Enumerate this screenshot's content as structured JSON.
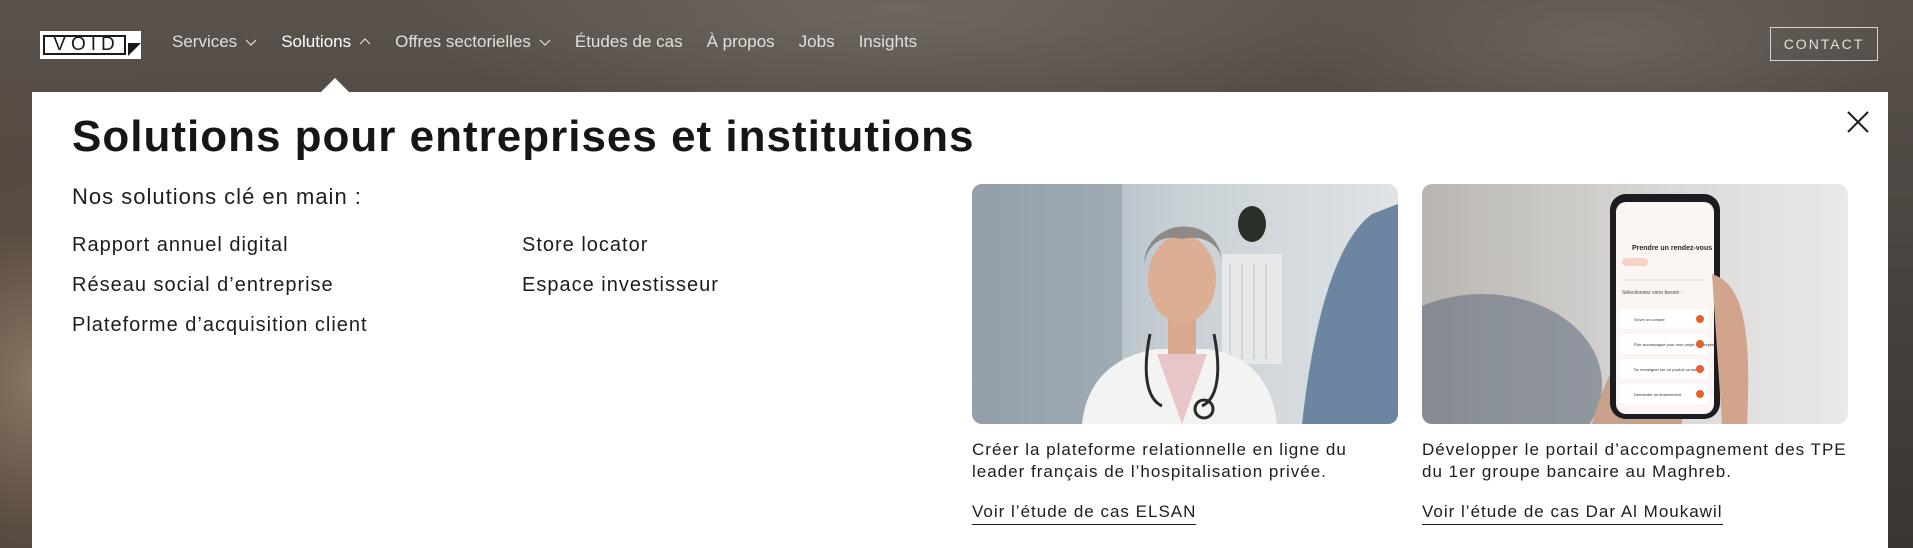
{
  "header": {
    "logo_text": "VOID",
    "nav": [
      {
        "label": "Services",
        "has_chevron": true
      },
      {
        "label": "Solutions",
        "has_chevron": true
      },
      {
        "label": "Offres sectorielles",
        "has_chevron": true
      },
      {
        "label": "Études de cas",
        "has_chevron": false
      },
      {
        "label": "À propos",
        "has_chevron": false
      },
      {
        "label": "Jobs",
        "has_chevron": false
      },
      {
        "label": "Insights",
        "has_chevron": false
      }
    ],
    "contact_label": "CONTACT"
  },
  "menu": {
    "title": "Solutions pour entreprises et institutions",
    "subtitle": "Nos solutions clé en main :",
    "links_col1": [
      "Rapport annuel digital",
      "Réseau social d’entreprise",
      "Plateforme d’acquisition client"
    ],
    "links_col2": [
      "Store locator",
      "Espace investisseur"
    ],
    "cards": [
      {
        "image": "doctor-photo",
        "description": "Créer la plateforme relationnelle en ligne du leader français de l’hospitalisation privée.",
        "link": "Voir l’étude de cas ELSAN"
      },
      {
        "image": "phone-app-photo",
        "description": "Développer le portail d’accompagnement des TPE du 1er groupe bancaire au Maghreb.",
        "link": "Voir l’étude de cas Dar Al Moukawil"
      }
    ]
  },
  "phone_screen": {
    "heading": "Prendre un rendez-vous",
    "prompt": "Sélectionnez votre besoin :",
    "options": [
      "Ouvrir un compte",
      "Être accompagné pour mon projet d'entreprise",
      "Se renseigner sur un produit ou service",
      "Demander un financement"
    ]
  },
  "colors": {
    "panel_bg": "#ffffff",
    "text": "#1d1d1d",
    "nav_text": "#e4dfda",
    "accent_app": "#e8602c"
  }
}
